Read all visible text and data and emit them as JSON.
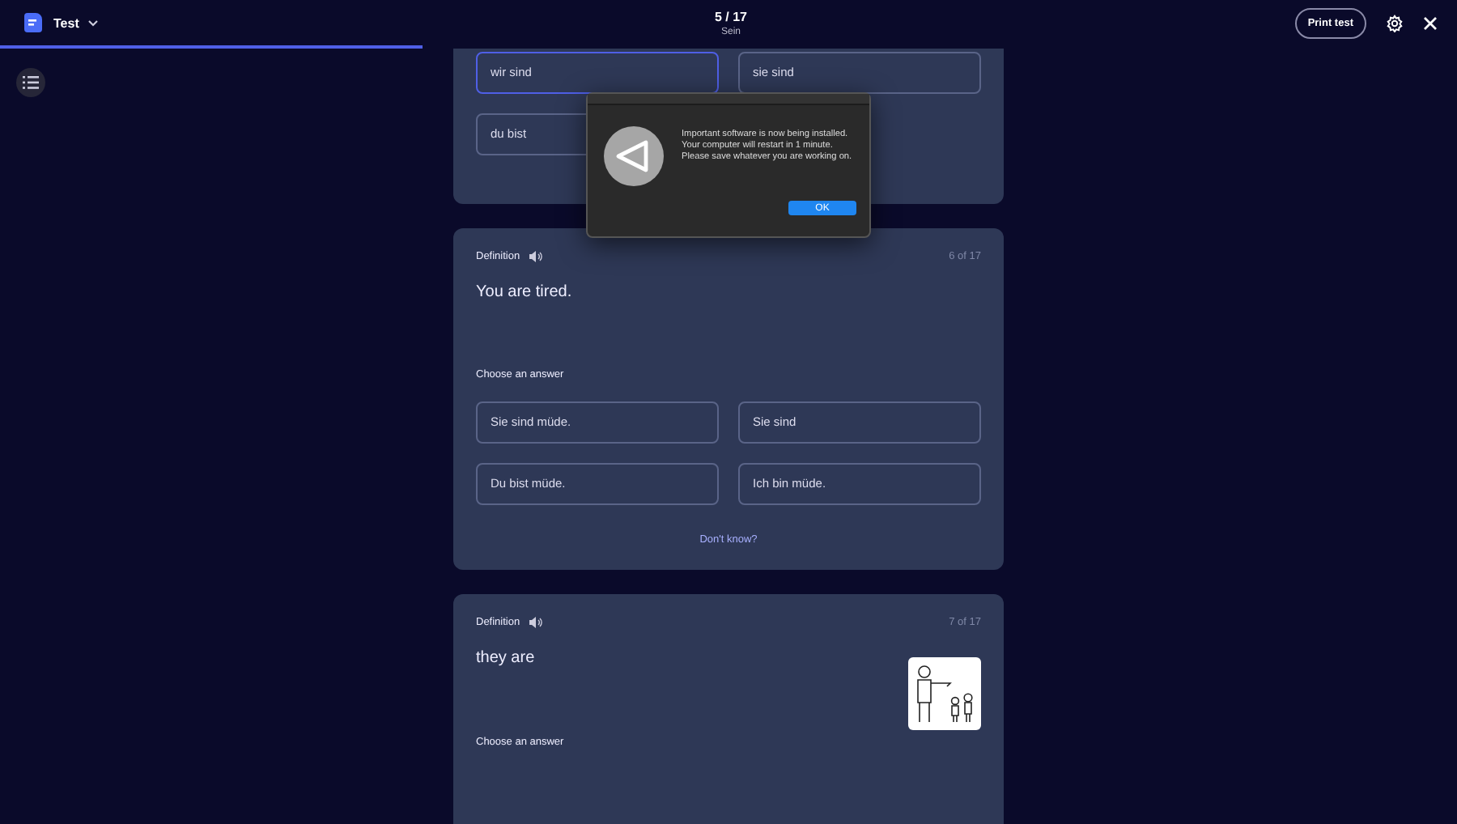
{
  "header": {
    "title": "Test",
    "counter": "5 / 17",
    "subtitle": "Sein",
    "print_button": "Print test",
    "progress": {
      "level": 0.29
    }
  },
  "cards": [
    {
      "answers": [
        {
          "text": "wir sind",
          "selected": true
        },
        {
          "text": "sie sind",
          "selected": false
        },
        {
          "text": "du bist",
          "selected": false
        }
      ]
    },
    {
      "label": "Definition",
      "counter": "6 of 17",
      "prompt": "You are tired.",
      "has_image": false,
      "choose_label": "Choose an answer",
      "answers": [
        {
          "text": "Sie sind müde.",
          "selected": false
        },
        {
          "text": "Sie sind",
          "selected": false
        },
        {
          "text": "Du bist müde.",
          "selected": false
        },
        {
          "text": "Ich bin müde.",
          "selected": false
        }
      ],
      "dont_know": "Don't know?"
    },
    {
      "label": "Definition",
      "counter": "7 of 17",
      "prompt": "they are",
      "has_image": true,
      "choose_label": "Choose an answer"
    }
  ],
  "dialog": {
    "lines": [
      "Important software is now being installed.",
      "Your computer will restart in 1 minute.",
      "Please save whatever you are working on."
    ],
    "button": "OK"
  }
}
